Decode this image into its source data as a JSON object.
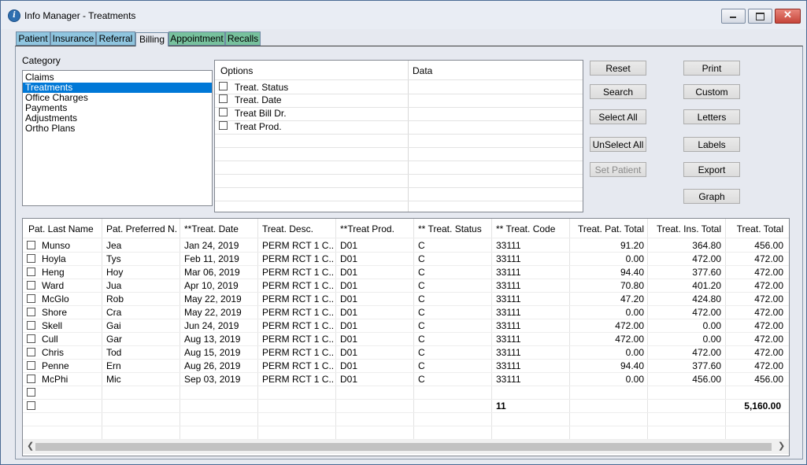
{
  "window": {
    "title": "Info Manager - Treatments"
  },
  "tabs": [
    "Patient",
    "Insurance",
    "Referral",
    "Billing",
    "Appointment",
    "Recalls"
  ],
  "category": {
    "label": "Category",
    "items": [
      "Claims",
      "Treatments",
      "Office Charges",
      "Payments",
      "Adjustments",
      "Ortho Plans"
    ],
    "selected": "Treatments"
  },
  "options": {
    "header_options": "Options",
    "header_data": "Data",
    "rows": [
      "Treat. Status",
      "Treat. Date",
      "Treat Bill Dr.",
      "Treat Prod."
    ]
  },
  "buttons": {
    "reset": "Reset",
    "search": "Search",
    "select_all": "Select All",
    "unselect_all": "UnSelect All",
    "set_patient": "Set Patient",
    "print": "Print",
    "custom": "Custom",
    "letters": "Letters",
    "labels": "Labels",
    "export": "Export",
    "graph": "Graph"
  },
  "table": {
    "columns": [
      "Pat. Last Name",
      "Pat. Preferred N...",
      "**Treat. Date",
      "Treat. Desc.",
      "**Treat Prod.",
      "** Treat. Status",
      "** Treat. Code",
      "Treat. Pat. Total",
      "Treat. Ins. Total",
      "Treat. Total"
    ],
    "rows": [
      [
        "Munso",
        "Jea",
        "Jan 24, 2019",
        "PERM RCT 1 C...",
        "D01",
        "C",
        "33111",
        "91.20",
        "364.80",
        "456.00"
      ],
      [
        "Hoyla",
        "Tys",
        "Feb 11, 2019",
        "PERM RCT 1 C...",
        "D01",
        "C",
        "33111",
        "0.00",
        "472.00",
        "472.00"
      ],
      [
        "Heng",
        "Hoy",
        "Mar 06, 2019",
        "PERM RCT 1 C...",
        "D01",
        "C",
        "33111",
        "94.40",
        "377.60",
        "472.00"
      ],
      [
        "Ward",
        "Jua",
        "Apr 10, 2019",
        "PERM RCT 1 C...",
        "D01",
        "C",
        "33111",
        "70.80",
        "401.20",
        "472.00"
      ],
      [
        "McGlo",
        "Rob",
        "May 22, 2019",
        "PERM RCT 1 C...",
        "D01",
        "C",
        "33111",
        "47.20",
        "424.80",
        "472.00"
      ],
      [
        "Shore",
        "Cra",
        "May 22, 2019",
        "PERM RCT 1 C...",
        "D01",
        "C",
        "33111",
        "0.00",
        "472.00",
        "472.00"
      ],
      [
        "Skell",
        "Gai",
        "Jun 24, 2019",
        "PERM RCT 1 C...",
        "D01",
        "C",
        "33111",
        "472.00",
        "0.00",
        "472.00"
      ],
      [
        "Cull",
        "Gar",
        "Aug 13, 2019",
        "PERM RCT 1 C...",
        "D01",
        "C",
        "33111",
        "472.00",
        "0.00",
        "472.00"
      ],
      [
        "Chris",
        "Tod",
        "Aug 15, 2019",
        "PERM RCT 1 C...",
        "D01",
        "C",
        "33111",
        "0.00",
        "472.00",
        "472.00"
      ],
      [
        "Penne",
        "Ern",
        "Aug 26, 2019",
        "PERM RCT 1 C...",
        "D01",
        "C",
        "33111",
        "94.40",
        "377.60",
        "472.00"
      ],
      [
        "McPhi",
        "Mic",
        "Sep 03, 2019",
        "PERM RCT 1 C...",
        "D01",
        "C",
        "33111",
        "0.00",
        "456.00",
        "456.00"
      ]
    ],
    "totals": {
      "count": "11",
      "grand_total": "5,160.00"
    }
  }
}
